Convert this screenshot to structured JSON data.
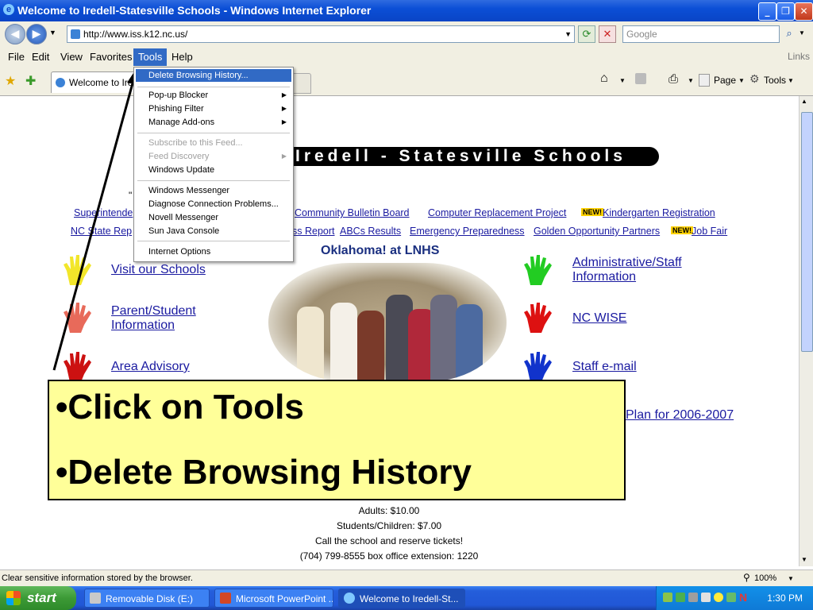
{
  "window": {
    "title": "Welcome to Iredell-Statesville Schools - Windows Internet Explorer"
  },
  "address": {
    "url": "http://www.iss.k12.nc.us/"
  },
  "search": {
    "placeholder": "Google"
  },
  "menubar": {
    "items": [
      "File",
      "Edit",
      "View",
      "Favorites",
      "Tools",
      "Help"
    ],
    "links": "Links"
  },
  "tabs": {
    "active": "Welcome to Iredell-Statesville Schools"
  },
  "toolbar": {
    "page": "Page",
    "tools": "Tools"
  },
  "tools_menu": {
    "items": [
      "Delete Browsing History...",
      "Pop-up Blocker",
      "Phishing Filter",
      "Manage Add-ons",
      "Subscribe to this Feed...",
      "Feed Discovery",
      "Windows Update",
      "Windows Messenger",
      "Diagnose Connection Problems...",
      "Novell Messenger",
      "Sun Java Console",
      "Internet Options"
    ]
  },
  "page": {
    "banner": "Iredell - Statesville Schools",
    "quote_mark": "\"",
    "links_row1": [
      "Superintende",
      "Community Bulletin Board",
      "Computer Replacement Project",
      "Kindergarten Registration"
    ],
    "links_row2": [
      "NC State Rep",
      "ss Report",
      "ABCs Results",
      "Emergency Preparedness",
      "Golden Opportunity Partners",
      "Job Fair"
    ],
    "new_badge": "NEW!",
    "feature_title": "Oklahoma! at LNHS",
    "left_links": [
      "Visit our Schools",
      "Parent/Student Information",
      "Area Advisory"
    ],
    "right_links": [
      "Administrative/Staff Information",
      "NC WISE",
      "Staff e-mail",
      "Plan for 2006-2007"
    ],
    "info_lines": [
      "Adults:  $10.00",
      "Students/Children:  $7.00",
      "Call the school and reserve tickets!",
      "(704) 799-8555 box office extension:  1220"
    ]
  },
  "callout": {
    "line1": "•Click on Tools",
    "line2": "•Delete Browsing History"
  },
  "status": {
    "text": "Clear sensitive information stored by the browser.",
    "zoom": "100%"
  },
  "taskbar": {
    "start": "start",
    "tasks": [
      "Removable Disk (E:)",
      "Microsoft PowerPoint ...",
      "Welcome to Iredell-St..."
    ],
    "clock": "1:30 PM"
  },
  "colors": {
    "callout_bg": "#ffff99",
    "menu_highlight": "#316ac5",
    "link": "#1a1aa0",
    "titlebar": "#0b4fd6"
  }
}
